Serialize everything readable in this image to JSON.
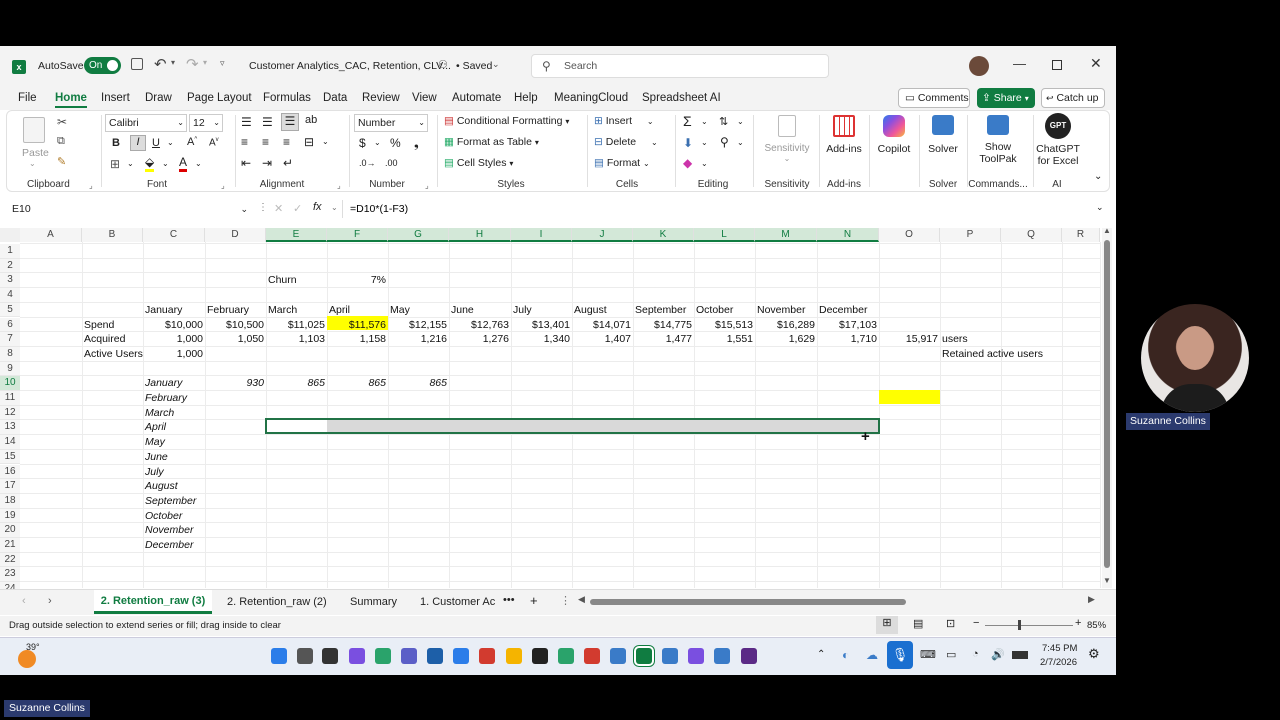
{
  "window": {
    "autosave_label": "AutoSave",
    "autosave_state": "On",
    "file_title": "Customer Analytics_CAC, Retention, CLV...",
    "saved_state": "• Saved",
    "search_placeholder": "Search",
    "comments_label": "Comments",
    "share_label": "Share",
    "catchup_label": "Catch up"
  },
  "ribbon_tabs": [
    "File",
    "Home",
    "Insert",
    "Draw",
    "Page Layout",
    "Formulas",
    "Data",
    "Review",
    "View",
    "Automate",
    "Help",
    "MeaningCloud",
    "Spreadsheet AI"
  ],
  "ribbon": {
    "paste": "Paste",
    "clipboard": "Clipboard",
    "font_name": "Calibri",
    "font_size": "12",
    "font": "Font",
    "alignment": "Alignment",
    "number_format": "Number",
    "number": "Number",
    "cond_format": "Conditional Formatting",
    "format_table": "Format as Table",
    "cell_styles": "Cell Styles",
    "styles": "Styles",
    "insert": "Insert",
    "delete": "Delete",
    "format": "Format",
    "cells": "Cells",
    "editing": "Editing",
    "sensitivity": "Sensitivity",
    "sensitivity_group": "Sensitivity",
    "addins": "Add-ins",
    "addins_group": "Add-ins",
    "copilot": "Copilot",
    "solver": "Solver",
    "solver_group": "Solver",
    "show_toolpak_1": "Show",
    "show_toolpak_2": "ToolPak",
    "commands_group": "Commands...",
    "chatgpt_1": "ChatGPT",
    "chatgpt_2": "for Excel",
    "gpt_badge": "GPT",
    "ai_group": "AI"
  },
  "formula_bar": {
    "name_box": "E10",
    "formula": "=D10*(1-F3)",
    "fx": "fx"
  },
  "columns": [
    "A",
    "B",
    "C",
    "D",
    "E",
    "F",
    "G",
    "H",
    "I",
    "J",
    "K",
    "L",
    "M",
    "N",
    "O",
    "P",
    "Q",
    "R"
  ],
  "rows": [
    "1",
    "2",
    "3",
    "4",
    "5",
    "6",
    "7",
    "8",
    "9",
    "10",
    "11",
    "12",
    "13",
    "14",
    "15",
    "16",
    "17",
    "18",
    "19",
    "20",
    "21",
    "22",
    "23",
    "24"
  ],
  "cells": {
    "churn_label": "Churn",
    "churn_value": "7%",
    "months": [
      "January",
      "February",
      "March",
      "April",
      "May",
      "June",
      "July",
      "August",
      "September",
      "October",
      "November",
      "December"
    ],
    "spend_label": "Spend",
    "spend": [
      "$10,000",
      "$10,500",
      "$11,025",
      "$11,576",
      "$12,155",
      "$12,763",
      "$13,401",
      "$14,071",
      "$14,775",
      "$15,513",
      "$16,289",
      "$17,103"
    ],
    "acquired_label": "Acquired",
    "acquired": [
      "1,000",
      "1,050",
      "1,103",
      "1,158",
      "1,216",
      "1,276",
      "1,340",
      "1,407",
      "1,477",
      "1,551",
      "1,629",
      "1,710"
    ],
    "acquired_total": "15,917",
    "users_label": "users",
    "active_label": "Active Users",
    "active_jan": "1,000",
    "retained_label": "Retained active users",
    "row10": [
      "930",
      "865",
      "865",
      "865"
    ],
    "cohort_months": [
      "January",
      "February",
      "March",
      "April",
      "May",
      "June",
      "July",
      "August",
      "September",
      "October",
      "November",
      "December"
    ]
  },
  "sheet_tabs": [
    "2. Retention_raw (3)",
    "2. Retention_raw (2)",
    "Summary",
    "1. Customer Ac"
  ],
  "status": {
    "message": "Drag outside selection to extend series or fill; drag inside to clear",
    "zoom": "85%"
  },
  "taskbar": {
    "weather": "39°",
    "time": "7:45 PM",
    "date": "2/7/2026"
  },
  "video": {
    "presenter_name": "Suzanne Collins",
    "caption_name": "Suzanne Collins"
  },
  "colors": {
    "excel_green": "#107c41",
    "highlight_yellow": "#ffff00",
    "selection_fill": "#d9d9d9"
  }
}
